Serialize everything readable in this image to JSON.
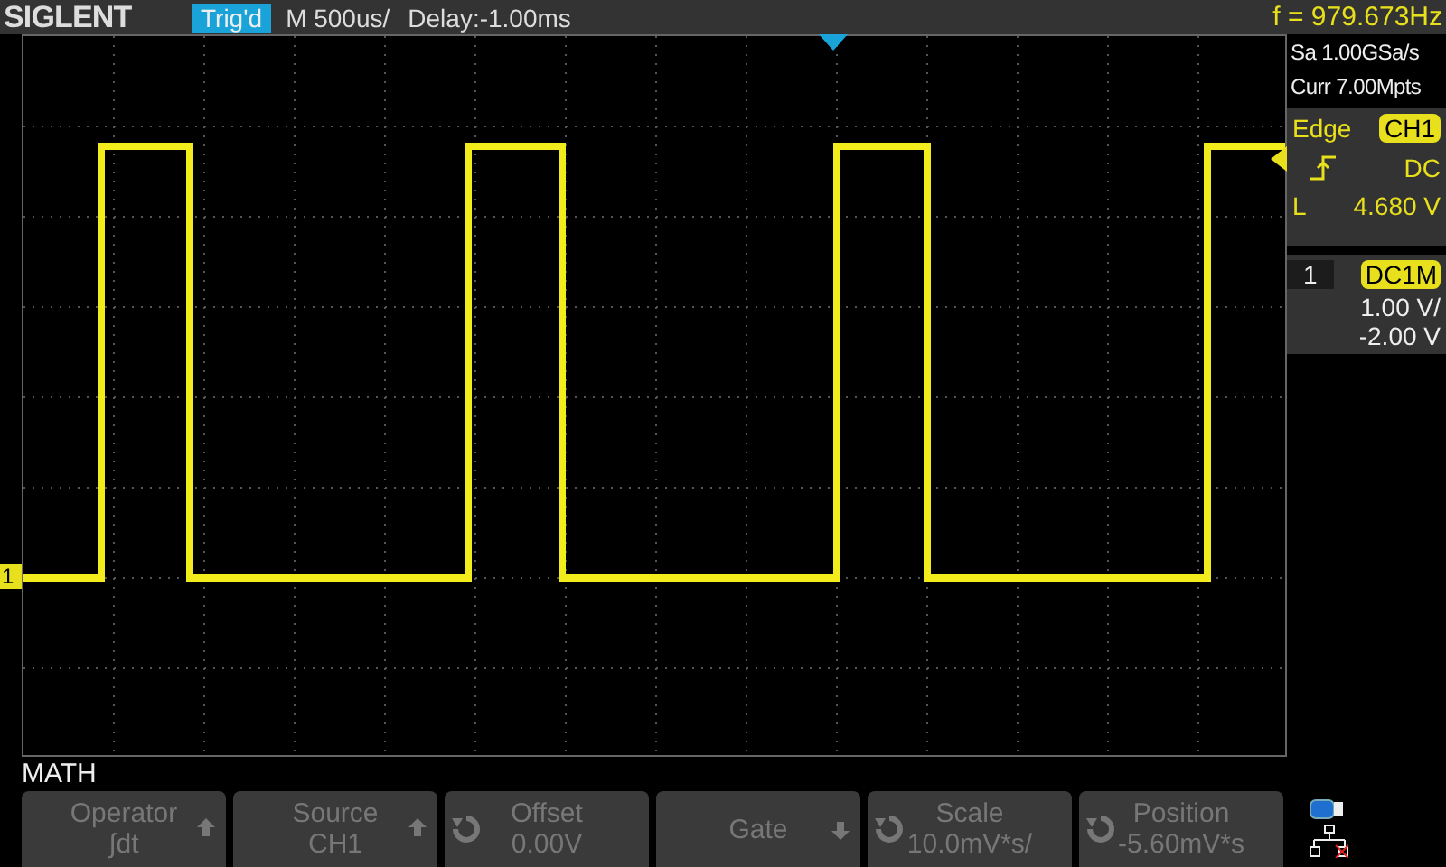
{
  "header": {
    "brand": "SIGLENT",
    "trigger_status": "Trig'd",
    "timebase": "M 500us/",
    "delay": "Delay:-1.00ms",
    "frequency": "f = 979.673Hz"
  },
  "channel_marker": "1",
  "acquisition": {
    "sample_rate": "Sa 1.00GSa/s",
    "memory": "Curr 7.00Mpts"
  },
  "trigger": {
    "type": "Edge",
    "source": "CH1",
    "coupling": "DC",
    "level_label": "L",
    "level": "4.680 V"
  },
  "channel": {
    "number": "1",
    "coupling": "DC1M",
    "scale": "1.00 V/",
    "offset": "-2.00 V"
  },
  "menu": {
    "title": "MATH",
    "buttons": [
      {
        "label": "Operator",
        "value": "∫dt",
        "kind": "up"
      },
      {
        "label": "Source",
        "value": "CH1",
        "kind": "up"
      },
      {
        "label": "Offset",
        "value": "0.00V",
        "kind": "knob"
      },
      {
        "label": "Gate",
        "kind": "down"
      },
      {
        "label": "Scale",
        "value": "10.0mV*s/",
        "kind": "knob"
      },
      {
        "label": "Position",
        "value": "-5.60mV*s",
        "kind": "knob"
      }
    ]
  }
}
